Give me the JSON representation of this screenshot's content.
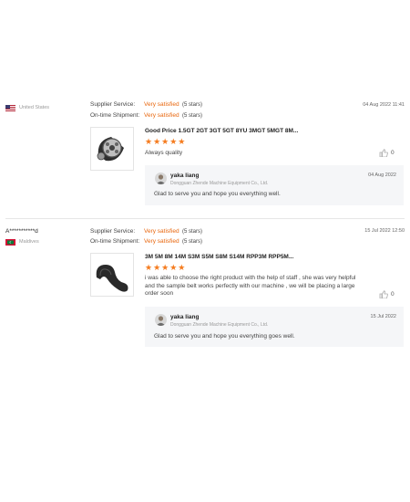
{
  "reviews": [
    {
      "buyer": "",
      "country": "United States",
      "supplier_service_label": "Supplier Service:",
      "supplier_service_value": "Very satisfied",
      "supplier_service_stars": "(5 stars)",
      "shipment_label": "On-time Shipment:",
      "shipment_value": "Very satisfied",
      "shipment_stars": "(5 stars)",
      "date": "04 Aug 2022 11:41",
      "product_title": "Good Price 1.5GT 2GT 3GT 5GT 8YU 3MGT 5MGT 8M...",
      "rating": 5,
      "stars_text": "★★★★★",
      "comment": "Always quality",
      "likes": "0",
      "reply": {
        "name": "yaka liang",
        "company": "Dongguan Zhende Machine Equipment Co., Ltd.",
        "date": "04 Aug 2022",
        "text": "Glad to serve you and hope you everything well."
      }
    },
    {
      "buyer": "A***********d",
      "country": "Maldives",
      "supplier_service_label": "Supplier Service:",
      "supplier_service_value": "Very satisfied",
      "supplier_service_stars": "(5 stars)",
      "shipment_label": "On-time Shipment:",
      "shipment_value": "Very satisfied",
      "shipment_stars": "(5 stars)",
      "date": "15 Jul 2022 12:50",
      "product_title": "3M 5M 8M 14M S3M S5M S8M S14M RPP3M RPP5M...",
      "rating": 5,
      "stars_text": "★★★★★",
      "comment": "i was able to choose the right product with the help of staff , she was very helpful and the sample  belt works perfectly with our machine , we will be placing a large order soon",
      "likes": "0",
      "reply": {
        "name": "yaka liang",
        "company": "Dongguan Zhende Machine Equipment Co., Ltd.",
        "date": "15 Jul 2022",
        "text": "Glad to serve you and hope you everything goes well."
      }
    }
  ]
}
